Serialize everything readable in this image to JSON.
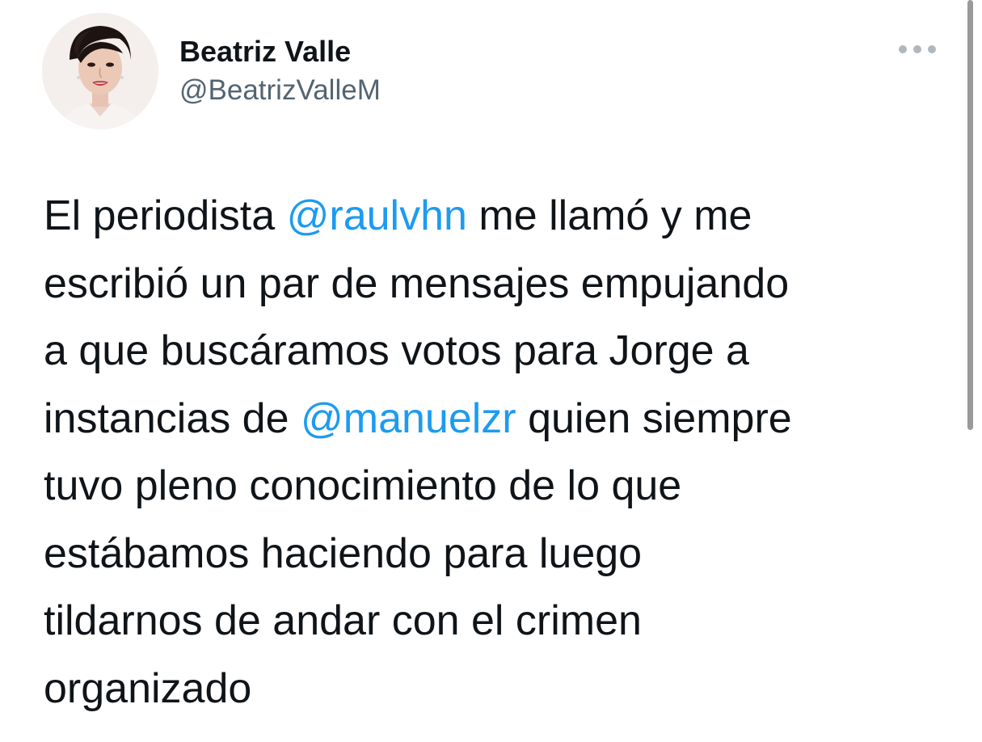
{
  "author": {
    "display_name": "Beatriz Valle",
    "handle": "@BeatrizValleM",
    "avatar_icon": "profile-photo"
  },
  "more_icon": "ellipsis-icon",
  "colors": {
    "mention": "#1d9bf0",
    "text": "#0f1419",
    "secondary": "#536471"
  },
  "tweet": {
    "lines": [
      {
        "parts": [
          {
            "text": "El periodista ",
            "mention": false
          },
          {
            "text": "@raulvhn",
            "mention": true
          },
          {
            "text": " me llamó y me",
            "mention": false
          }
        ]
      },
      {
        "parts": [
          {
            "text": "escribió un par de mensajes empujando",
            "mention": false
          }
        ]
      },
      {
        "parts": [
          {
            "text": "a que buscáramos votos para Jorge a",
            "mention": false
          }
        ]
      },
      {
        "parts": [
          {
            "text": "instancias de ",
            "mention": false
          },
          {
            "text": "@manuelzr",
            "mention": true
          },
          {
            "text": " quien siempre",
            "mention": false
          }
        ]
      },
      {
        "parts": [
          {
            "text": "tuvo pleno conocimiento de lo que",
            "mention": false
          }
        ]
      },
      {
        "parts": [
          {
            "text": "estábamos haciendo para luego",
            "mention": false
          }
        ]
      },
      {
        "parts": [
          {
            "text": "tildarnos de andar con el crimen",
            "mention": false
          }
        ]
      },
      {
        "parts": [
          {
            "text": "organizado",
            "mention": false
          }
        ]
      }
    ]
  }
}
